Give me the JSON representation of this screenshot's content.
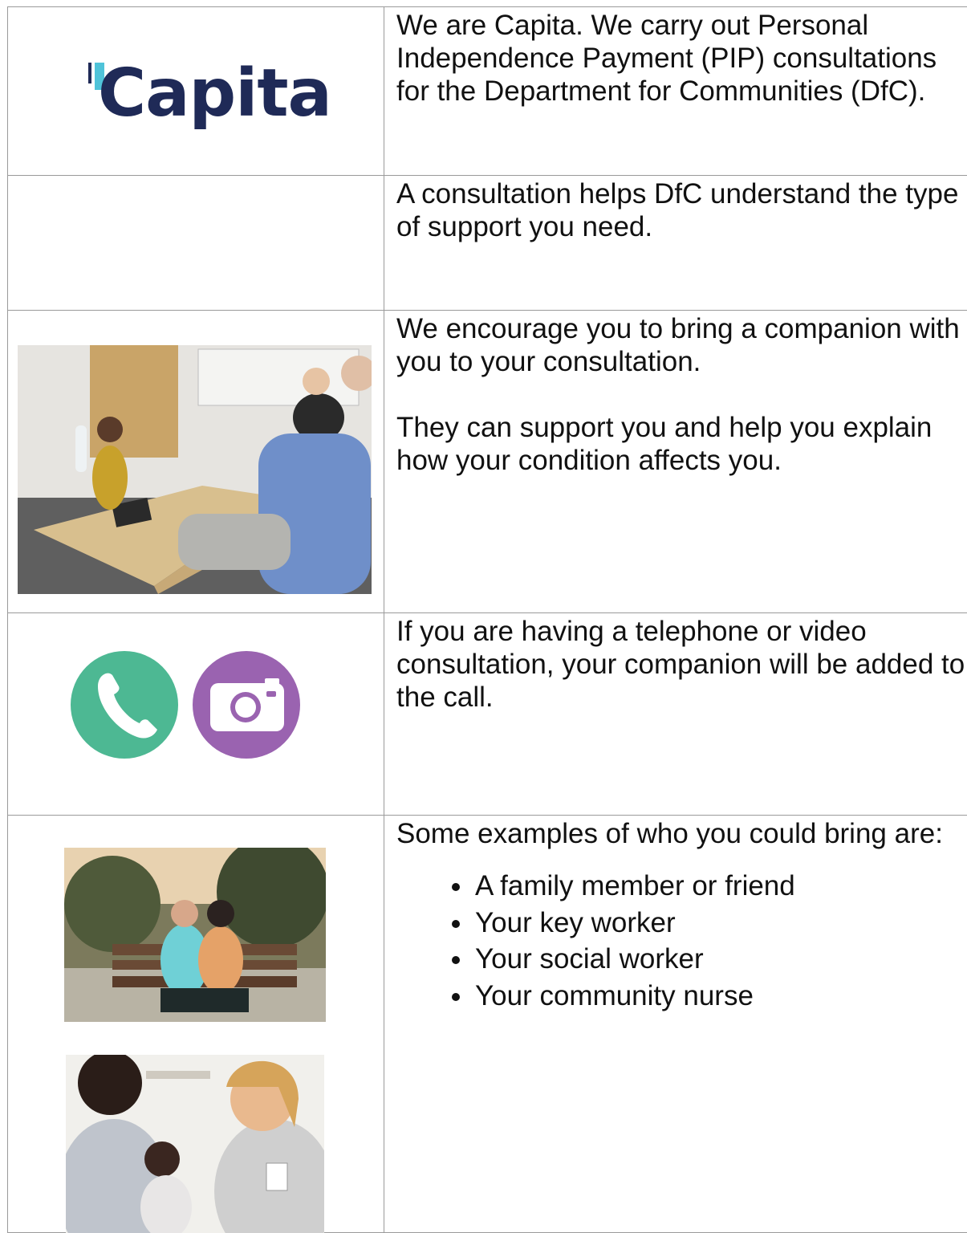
{
  "logo": {
    "text": "Capita",
    "text_color": "#1f2a57",
    "accent_color": "#4fc3d9"
  },
  "rows": {
    "intro": "We are Capita. We carry out Personal Independence Payment (PIP) consultations for the Department for Communities (DfC).",
    "consultation": "A consultation helps DfC understand the type of support you need.",
    "companion_1": "We encourage you to bring a companion with you to your consultation.",
    "companion_2": "They can support you and help you explain how your condition affects you.",
    "call": "If you are having a telephone or video consultation, your companion will be added to the call.",
    "examples_intro": "Some examples of who you could bring are:",
    "examples": [
      "A family member or friend",
      "Your key worker",
      "Your social worker",
      "Your community nurse"
    ]
  },
  "icons": {
    "phone": {
      "name": "phone-icon",
      "color": "#4db893"
    },
    "camera": {
      "name": "camera-icon",
      "color": "#9a63b0"
    }
  },
  "photos": [
    "consultation-room-photo",
    "park-bench-photo",
    "nurse-visit-photo"
  ]
}
